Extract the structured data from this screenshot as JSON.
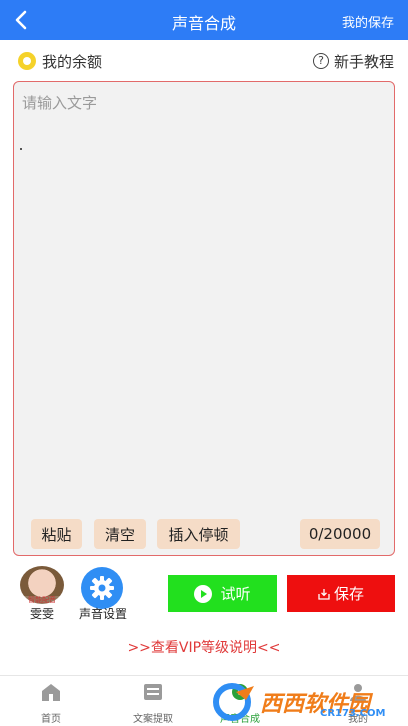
{
  "header": {
    "title": "声音合成",
    "save_label": "我的保存"
  },
  "balance": {
    "label": "我的余额"
  },
  "tutorial": {
    "label": "新手教程",
    "icon_text": "?"
  },
  "editor": {
    "placeholder": "请输入文字",
    "buttons": {
      "paste": "粘贴",
      "clear": "清空",
      "insert_pause": "插入停顿"
    },
    "char_count": "0/20000"
  },
  "voice": {
    "avatar_tag": "智能配音",
    "name": "雯雯",
    "settings_label": "声音设置"
  },
  "actions": {
    "listen_label": "试听",
    "save_label": "保存"
  },
  "vip_link": ">>查看VIP等级说明<<",
  "nav": [
    {
      "label": "首页",
      "icon": "home-icon"
    },
    {
      "label": "文案提取",
      "icon": "extract-icon"
    },
    {
      "label": "声音合成",
      "icon": "voice-icon"
    },
    {
      "label": "我的",
      "icon": "user-icon"
    }
  ],
  "watermark": {
    "text": "西西软件园",
    "sub": "CR173.COM"
  },
  "colors": {
    "primary": "#2d7cf6",
    "listen": "#22e01e",
    "save": "#ee0f0f",
    "vip": "#e03a3a"
  }
}
